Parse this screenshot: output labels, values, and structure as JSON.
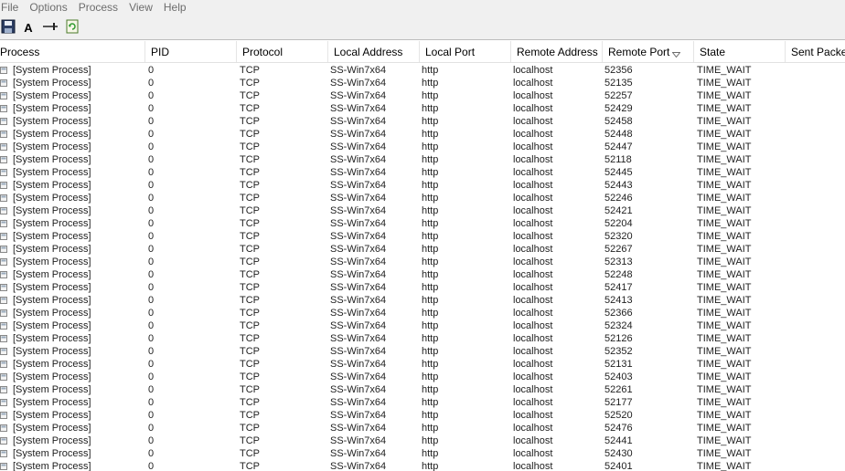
{
  "menu": {
    "items": [
      "File",
      "Options",
      "Process",
      "View",
      "Help"
    ]
  },
  "toolbar": {
    "buttons": [
      "save-icon",
      "font-icon",
      "pin-icon",
      "refresh-icon"
    ],
    "font_button_label": "A"
  },
  "table": {
    "columns": [
      "Process",
      "PID",
      "Protocol",
      "Local Address",
      "Local Port",
      "Remote Address",
      "Remote Port",
      "State",
      "Sent Packets"
    ],
    "sorted_column": "Remote Port",
    "sort_direction": "descending",
    "rows": [
      [
        "[System Process]",
        "0",
        "TCP",
        "SS-Win7x64",
        "http",
        "localhost",
        "52356",
        "TIME_WAIT"
      ],
      [
        "[System Process]",
        "0",
        "TCP",
        "SS-Win7x64",
        "http",
        "localhost",
        "52135",
        "TIME_WAIT"
      ],
      [
        "[System Process]",
        "0",
        "TCP",
        "SS-Win7x64",
        "http",
        "localhost",
        "52257",
        "TIME_WAIT"
      ],
      [
        "[System Process]",
        "0",
        "TCP",
        "SS-Win7x64",
        "http",
        "localhost",
        "52429",
        "TIME_WAIT"
      ],
      [
        "[System Process]",
        "0",
        "TCP",
        "SS-Win7x64",
        "http",
        "localhost",
        "52458",
        "TIME_WAIT"
      ],
      [
        "[System Process]",
        "0",
        "TCP",
        "SS-Win7x64",
        "http",
        "localhost",
        "52448",
        "TIME_WAIT"
      ],
      [
        "[System Process]",
        "0",
        "TCP",
        "SS-Win7x64",
        "http",
        "localhost",
        "52447",
        "TIME_WAIT"
      ],
      [
        "[System Process]",
        "0",
        "TCP",
        "SS-Win7x64",
        "http",
        "localhost",
        "52118",
        "TIME_WAIT"
      ],
      [
        "[System Process]",
        "0",
        "TCP",
        "SS-Win7x64",
        "http",
        "localhost",
        "52445",
        "TIME_WAIT"
      ],
      [
        "[System Process]",
        "0",
        "TCP",
        "SS-Win7x64",
        "http",
        "localhost",
        "52443",
        "TIME_WAIT"
      ],
      [
        "[System Process]",
        "0",
        "TCP",
        "SS-Win7x64",
        "http",
        "localhost",
        "52246",
        "TIME_WAIT"
      ],
      [
        "[System Process]",
        "0",
        "TCP",
        "SS-Win7x64",
        "http",
        "localhost",
        "52421",
        "TIME_WAIT"
      ],
      [
        "[System Process]",
        "0",
        "TCP",
        "SS-Win7x64",
        "http",
        "localhost",
        "52204",
        "TIME_WAIT"
      ],
      [
        "[System Process]",
        "0",
        "TCP",
        "SS-Win7x64",
        "http",
        "localhost",
        "52320",
        "TIME_WAIT"
      ],
      [
        "[System Process]",
        "0",
        "TCP",
        "SS-Win7x64",
        "http",
        "localhost",
        "52267",
        "TIME_WAIT"
      ],
      [
        "[System Process]",
        "0",
        "TCP",
        "SS-Win7x64",
        "http",
        "localhost",
        "52313",
        "TIME_WAIT"
      ],
      [
        "[System Process]",
        "0",
        "TCP",
        "SS-Win7x64",
        "http",
        "localhost",
        "52248",
        "TIME_WAIT"
      ],
      [
        "[System Process]",
        "0",
        "TCP",
        "SS-Win7x64",
        "http",
        "localhost",
        "52417",
        "TIME_WAIT"
      ],
      [
        "[System Process]",
        "0",
        "TCP",
        "SS-Win7x64",
        "http",
        "localhost",
        "52413",
        "TIME_WAIT"
      ],
      [
        "[System Process]",
        "0",
        "TCP",
        "SS-Win7x64",
        "http",
        "localhost",
        "52366",
        "TIME_WAIT"
      ],
      [
        "[System Process]",
        "0",
        "TCP",
        "SS-Win7x64",
        "http",
        "localhost",
        "52324",
        "TIME_WAIT"
      ],
      [
        "[System Process]",
        "0",
        "TCP",
        "SS-Win7x64",
        "http",
        "localhost",
        "52126",
        "TIME_WAIT"
      ],
      [
        "[System Process]",
        "0",
        "TCP",
        "SS-Win7x64",
        "http",
        "localhost",
        "52352",
        "TIME_WAIT"
      ],
      [
        "[System Process]",
        "0",
        "TCP",
        "SS-Win7x64",
        "http",
        "localhost",
        "52131",
        "TIME_WAIT"
      ],
      [
        "[System Process]",
        "0",
        "TCP",
        "SS-Win7x64",
        "http",
        "localhost",
        "52403",
        "TIME_WAIT"
      ],
      [
        "[System Process]",
        "0",
        "TCP",
        "SS-Win7x64",
        "http",
        "localhost",
        "52261",
        "TIME_WAIT"
      ],
      [
        "[System Process]",
        "0",
        "TCP",
        "SS-Win7x64",
        "http",
        "localhost",
        "52177",
        "TIME_WAIT"
      ],
      [
        "[System Process]",
        "0",
        "TCP",
        "SS-Win7x64",
        "http",
        "localhost",
        "52520",
        "TIME_WAIT"
      ],
      [
        "[System Process]",
        "0",
        "TCP",
        "SS-Win7x64",
        "http",
        "localhost",
        "52476",
        "TIME_WAIT"
      ],
      [
        "[System Process]",
        "0",
        "TCP",
        "SS-Win7x64",
        "http",
        "localhost",
        "52441",
        "TIME_WAIT"
      ],
      [
        "[System Process]",
        "0",
        "TCP",
        "SS-Win7x64",
        "http",
        "localhost",
        "52430",
        "TIME_WAIT"
      ],
      [
        "[System Process]",
        "0",
        "TCP",
        "SS-Win7x64",
        "http",
        "localhost",
        "52401",
        "TIME_WAIT"
      ]
    ]
  },
  "colors": {
    "chrome_background": "#f0f0f0",
    "menu_text": "#6d6d6d",
    "grid_background": "#ffffff",
    "header_divider": "#e5e5e5"
  }
}
